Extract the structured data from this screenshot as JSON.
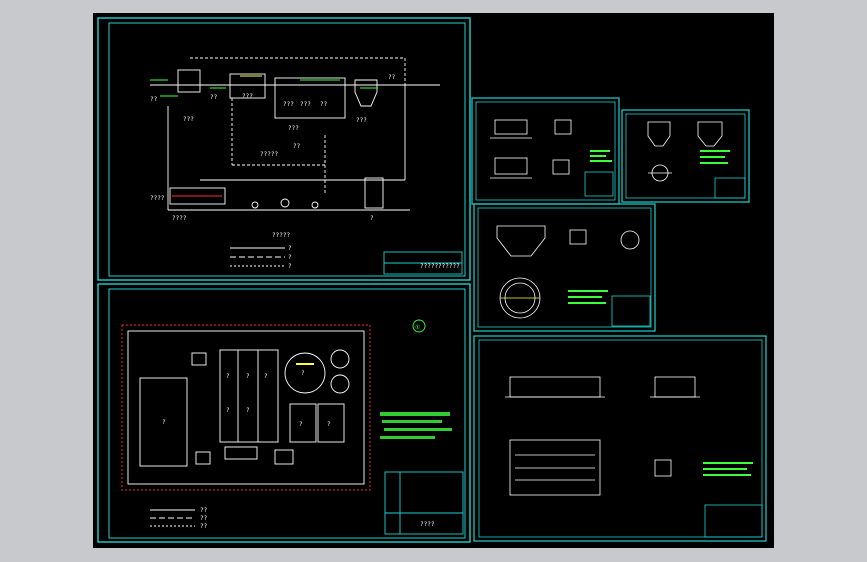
{
  "canvas": {
    "background": "#000000",
    "frame": "#1fd2d2",
    "line": "#ffffff",
    "accent_green": "#3cff3c",
    "accent_yellow": "#ffff3c",
    "accent_red": "#ff2a2a"
  },
  "sheet1": {
    "labels": {
      "l1": "??",
      "l2": "???",
      "l3": "??",
      "l4": "???",
      "l5": "???",
      "l6": "???",
      "l7": "??",
      "l8": "??",
      "l9": "???",
      "l10": "??",
      "l11": "???",
      "l12": "????",
      "l13": "????",
      "l14": "?????",
      "l15": "?",
      "l16": "?????"
    },
    "legend": [
      "?",
      "?",
      "?"
    ],
    "title_block": "???????????"
  },
  "sheet2": {
    "circle_marker": "①",
    "tank_labels": [
      "?",
      "?",
      "?",
      "?",
      "?",
      "?",
      "?",
      "?",
      "?"
    ],
    "legend": [
      "??",
      "??",
      "??"
    ],
    "title_block": "????"
  }
}
